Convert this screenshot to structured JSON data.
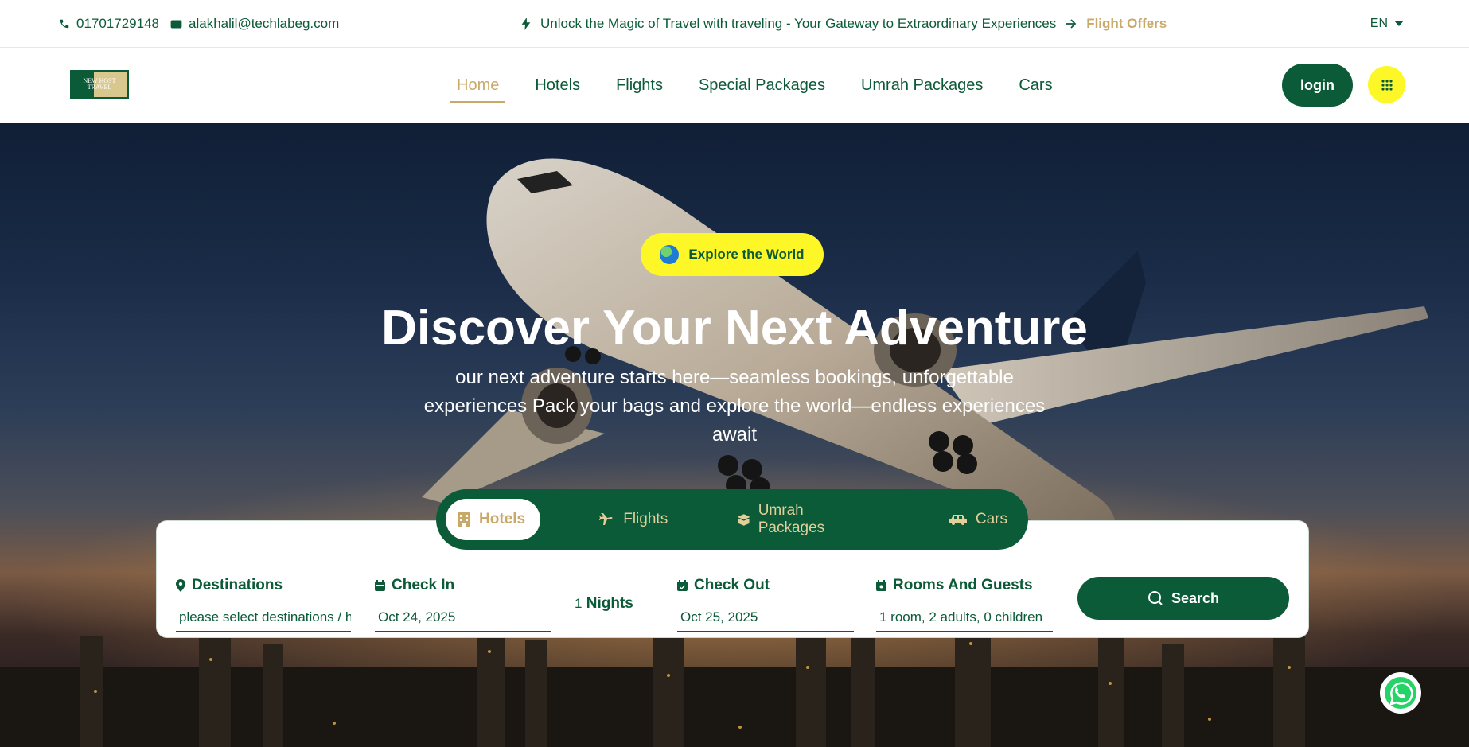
{
  "topbar": {
    "phone": "01701729148",
    "email": "alakhalil@techlabeg.com",
    "promo_text": "Unlock the Magic of Travel with traveling - Your Gateway to Extraordinary Experiences",
    "offers_link": "Flight Offers",
    "language": "EN"
  },
  "nav": {
    "logo_text": "NEW HOST TRAVEL",
    "items": [
      {
        "label": "Home",
        "active": true
      },
      {
        "label": "Hotels"
      },
      {
        "label": "Flights"
      },
      {
        "label": "Special Packages"
      },
      {
        "label": "Umrah Packages"
      },
      {
        "label": "Cars"
      }
    ],
    "login_label": "login"
  },
  "hero": {
    "badge": "Explore the World",
    "title": "Discover Your Next Adventure",
    "subtitle": "our next adventure starts here—seamless bookings, unforgettable experiences Pack your bags and explore the world—endless experiences await"
  },
  "tabs": [
    {
      "label": "Hotels",
      "icon": "building-icon",
      "active": true
    },
    {
      "label": "Flights",
      "icon": "plane-icon"
    },
    {
      "label": "Umrah Packages",
      "icon": "kaaba-icon"
    },
    {
      "label": "Cars",
      "icon": "car-icon"
    }
  ],
  "search": {
    "destinations_label": "Destinations",
    "destinations_placeholder": "please select destinations / h",
    "checkin_label": "Check In",
    "checkin_value": "Oct 24, 2025",
    "nights_count": "1",
    "nights_label": "Nights",
    "checkout_label": "Check Out",
    "checkout_value": "Oct 25, 2025",
    "guests_label": "Rooms And Guests",
    "guests_value": "1 room, 2 adults, 0 children",
    "search_label": "Search"
  },
  "colors": {
    "brand_green": "#0b5a38",
    "accent_gold": "#c9a96a",
    "accent_yellow": "#fdf728"
  }
}
